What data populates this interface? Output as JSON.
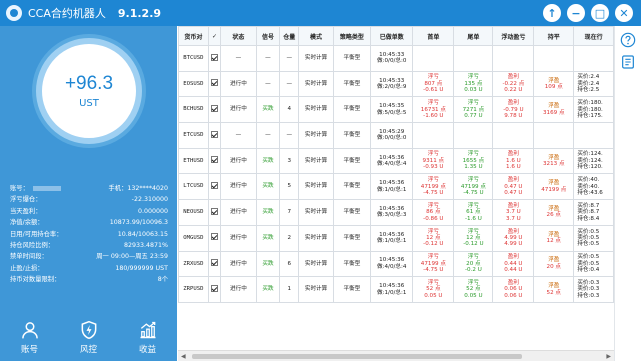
{
  "titlebar": {
    "app_name": "CCA合约机器人",
    "version": "9.1.2.9",
    "btn_up": "↑",
    "btn_min": "−",
    "btn_max": "□",
    "btn_close": "✕"
  },
  "sidebar": {
    "pnl": "+96.3",
    "unit": "UST",
    "info": [
      {
        "label": "账号：",
        "value": "手机：132****4020",
        "masked": true
      },
      {
        "label": "浮亏爆仓：",
        "value": "-22.310000"
      },
      {
        "label": "当天盈利：",
        "value": "0.000000"
      },
      {
        "label": "净值/余额：",
        "value": "10873.99/10096.3"
      },
      {
        "label": "日用/可用持仓率：",
        "value": "10.84/10063.15"
      },
      {
        "label": "持仓风险比例：",
        "value": "82933.4871%"
      },
      {
        "label": "禁单时间段：",
        "value": "周一 09:00—周五 23:59"
      },
      {
        "label": "止盈/止损：",
        "value": "180/999999 UST"
      },
      {
        "label": "持币对数量限制：",
        "value": "8个"
      }
    ],
    "nav": [
      {
        "label": "账号",
        "icon": "user-icon"
      },
      {
        "label": "风控",
        "icon": "shield-bolt-icon"
      },
      {
        "label": "收益",
        "icon": "chart-up-icon"
      }
    ]
  },
  "table": {
    "headers": [
      "货币对",
      "✓",
      "状态",
      "信号",
      "仓量",
      "模式",
      "策略类型",
      "已做单数",
      "首单",
      "尾单",
      "浮动盈亏",
      "持平",
      "现在行"
    ],
    "rows": [
      {
        "sym": "BTCUSD",
        "status": "—",
        "signal": "—",
        "pos": "—",
        "mode": "实时计算",
        "strategy": "平衡型",
        "orders": [
          "10:45:33",
          "做:0/0/总:0"
        ],
        "first": [],
        "last": [],
        "float": [],
        "flat": [],
        "now": []
      },
      {
        "sym": "EOSUSD",
        "status": "进行中",
        "signal": "—",
        "pos": "—",
        "mode": "实时计算",
        "strategy": "平衡型",
        "orders": [
          "10:45:33",
          "做:2/0/总:9"
        ],
        "first": [
          "浮亏",
          "807 点",
          "-0.61 U"
        ],
        "last": [
          "浮亏",
          "135 点",
          "0.03 U"
        ],
        "float": [
          "盈利",
          "-0.22 点",
          "0.22 U"
        ],
        "flat": [
          "浮盈",
          "109 点"
        ],
        "now": [
          "买价:2.4",
          "卖价:2.4",
          "持仓:2.5"
        ]
      },
      {
        "sym": "BCHUSD",
        "status": "进行中",
        "signal": "买跌",
        "pos": "4",
        "mode": "实时计算",
        "strategy": "平衡型",
        "orders": [
          "10:45:35",
          "做:5/0/总:5"
        ],
        "first": [
          "浮亏",
          "16731 点",
          "-1.60 U"
        ],
        "last": [
          "浮亏",
          "7271 点",
          "0.77 U"
        ],
        "float": [
          "盈利",
          "-0.79 U",
          "9.78 U"
        ],
        "flat": [
          "浮盈",
          "3169 点"
        ],
        "now": [
          "买价:180.",
          "卖价:180.",
          "持仓:175."
        ]
      },
      {
        "sym": "ETCUSD",
        "status": "—",
        "signal": "—",
        "pos": "—",
        "mode": "实时计算",
        "strategy": "平衡型",
        "orders": [
          "10:45:29",
          "做:0/0/总:0"
        ],
        "first": [],
        "last": [],
        "float": [],
        "flat": [],
        "now": []
      },
      {
        "sym": "ETHUSD",
        "status": "进行中",
        "signal": "买跌",
        "pos": "3",
        "mode": "实时计算",
        "strategy": "平衡型",
        "orders": [
          "10:45:36",
          "做:4/0/总:4"
        ],
        "first": [
          "浮亏",
          "9311 点",
          "-0.93 U"
        ],
        "last": [
          "浮亏",
          "1655 点",
          "1.35 U"
        ],
        "float": [
          "盈利",
          "1.6 U",
          "1.6 U"
        ],
        "flat": [
          "浮盈",
          "3213 点"
        ],
        "now": [
          "买价:124.",
          "卖价:124.",
          "持仓:120."
        ]
      },
      {
        "sym": "LTCUSD",
        "status": "进行中",
        "signal": "买跌",
        "pos": "5",
        "mode": "实时计算",
        "strategy": "平衡型",
        "orders": [
          "10:45:36",
          "做:1/0/总:1"
        ],
        "first": [
          "浮亏",
          "47199 点",
          "-4.75 U"
        ],
        "last": [
          "浮亏",
          "47199 点",
          "-4.75 U"
        ],
        "float": [
          "盈利",
          "0.47 U",
          "0.47 U"
        ],
        "flat": [
          "浮盈",
          "47199 点"
        ],
        "now": [
          "买价:40.",
          "卖价:40.",
          "持仓:43.6"
        ]
      },
      {
        "sym": "NEOUSD",
        "status": "进行中",
        "signal": "买跌",
        "pos": "7",
        "mode": "实时计算",
        "strategy": "平衡型",
        "orders": [
          "10:45:36",
          "做:3/0/总:3"
        ],
        "first": [
          "浮亏",
          "86 点",
          "-0.86 U"
        ],
        "last": [
          "浮亏",
          "61 点",
          "-1.6 U"
        ],
        "float": [
          "盈利",
          "3.7 U",
          "3.7 U"
        ],
        "flat": [
          "浮盈",
          "26 点"
        ],
        "now": [
          "买价:8.7",
          "卖价:8.7",
          "持仓:8.4"
        ]
      },
      {
        "sym": "OMGUSD",
        "status": "进行中",
        "signal": "买跌",
        "pos": "2",
        "mode": "实时计算",
        "strategy": "平衡型",
        "orders": [
          "10:45:36",
          "做:1/0/总:1"
        ],
        "first": [
          "浮亏",
          "12 点",
          "-0.12 U"
        ],
        "last": [
          "浮亏",
          "12 点",
          "-0.12 U"
        ],
        "float": [
          "盈利",
          "4.99 U",
          "4.99 U"
        ],
        "flat": [
          "浮盈",
          "12 点"
        ],
        "now": [
          "买价:0.5",
          "卖价:0.5",
          "持仓:0.5"
        ]
      },
      {
        "sym": "ZRXUSD",
        "status": "进行中",
        "signal": "买跌",
        "pos": "6",
        "mode": "实时计算",
        "strategy": "平衡型",
        "orders": [
          "10:45:36",
          "做:4/0/总:4"
        ],
        "first": [
          "浮亏",
          "47199 点",
          "-4.75 U"
        ],
        "last": [
          "浮亏",
          "20 点",
          "-0.2 U"
        ],
        "float": [
          "盈利",
          "0.44 U",
          "0.44 U"
        ],
        "flat": [
          "浮盈",
          "20 点"
        ],
        "now": [
          "买价:0.5",
          "卖价:0.5",
          "持仓:0.4"
        ]
      },
      {
        "sym": "ZRPUSD",
        "status": "进行中",
        "signal": "买跌",
        "pos": "1",
        "mode": "实时计算",
        "strategy": "平衡型",
        "orders": [
          "10:45:36",
          "做:1/0/总:1"
        ],
        "first": [
          "浮亏",
          "52 点",
          "0.05 U"
        ],
        "last": [
          "浮亏",
          "52 点",
          "0.05 U"
        ],
        "float": [
          "盈利",
          "0.06 U",
          "0.06 U"
        ],
        "flat": [
          "浮盈",
          "52 点"
        ],
        "now": [
          "买价:0.3",
          "卖价:0.3",
          "持仓:0.3"
        ]
      }
    ]
  },
  "rightbar": {
    "icons": [
      "help-icon",
      "document-icon"
    ]
  },
  "colors": {
    "titlebar": "#1e86d3",
    "sidebar": "#3f97d7",
    "ring_border": "#9fd0f2",
    "loss": "#d33",
    "gain": "#2a9a2a",
    "flat": "#c86400"
  }
}
